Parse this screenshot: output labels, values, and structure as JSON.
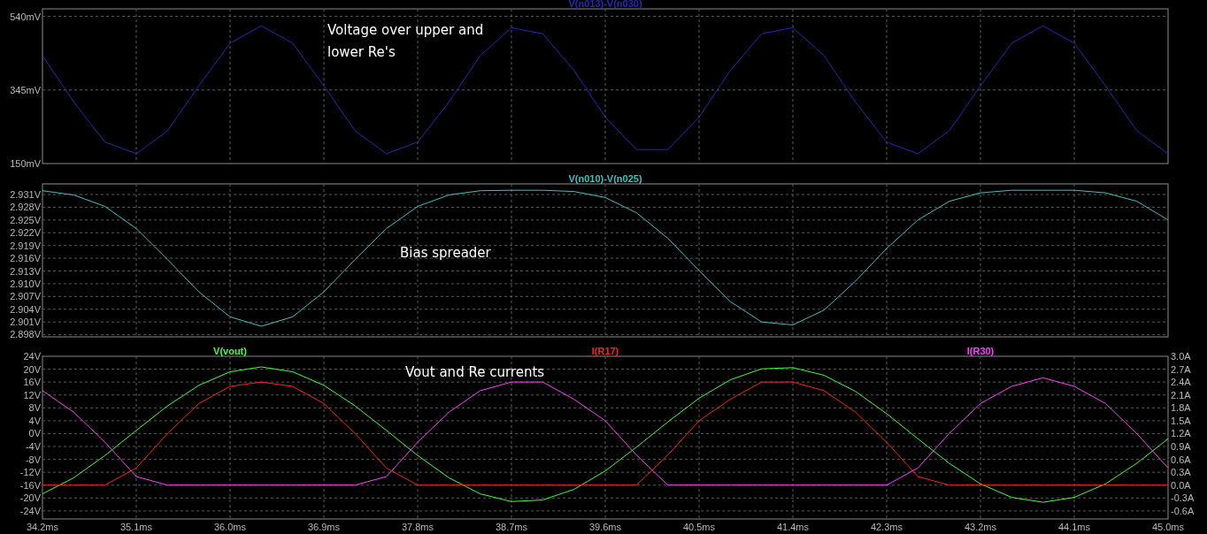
{
  "panes": [
    {
      "chart_data": {
        "type": "line",
        "xlim": [
          34.2,
          45.0
        ],
        "ylim": [
          150,
          560
        ],
        "yticks": [
          {
            "value": 540,
            "label": "540mV"
          },
          {
            "value": 345,
            "label": "345mV"
          },
          {
            "value": 150,
            "label": "150mV"
          }
        ],
        "x": [
          34.2,
          34.5,
          34.8,
          35.1,
          35.4,
          35.7,
          36.0,
          36.3,
          36.6,
          36.9,
          37.2,
          37.5,
          37.8,
          38.1,
          38.4,
          38.7,
          39.0,
          39.3,
          39.6,
          39.9,
          40.2,
          40.5,
          40.8,
          41.1,
          41.4,
          41.7,
          42.0,
          42.3,
          42.6,
          42.9,
          43.2,
          43.5,
          43.8,
          44.1,
          44.4,
          44.7,
          45.0
        ],
        "series": [
          {
            "name": "V(n013)-V(n030)",
            "color": "#2828b8",
            "values": [
              436,
              313,
              207,
              176,
              237,
              356,
              469,
              515,
              469,
              356,
              237,
              176,
              207,
              313,
              436,
              510,
              494,
              397,
              273,
              187,
              187,
              273,
              397,
              494,
              510,
              436,
              313,
              207,
              176,
              237,
              356,
              469,
              515,
              469,
              356,
              237,
              176
            ]
          }
        ],
        "grid": true,
        "annotations": [
          "Voltage over upper and lower Re's"
        ]
      }
    },
    {
      "chart_data": {
        "type": "line",
        "xlim": [
          34.2,
          45.0
        ],
        "ylim": [
          2.8975,
          2.9335
        ],
        "yticks": [
          {
            "value": 2.931,
            "label": "2.931V"
          },
          {
            "value": 2.928,
            "label": "2.928V"
          },
          {
            "value": 2.925,
            "label": "2.925V"
          },
          {
            "value": 2.922,
            "label": "2.922V"
          },
          {
            "value": 2.919,
            "label": "2.919V"
          },
          {
            "value": 2.916,
            "label": "2.916V"
          },
          {
            "value": 2.913,
            "label": "2.913V"
          },
          {
            "value": 2.91,
            "label": "2.910V"
          },
          {
            "value": 2.907,
            "label": "2.907V"
          },
          {
            "value": 2.904,
            "label": "2.904V"
          },
          {
            "value": 2.901,
            "label": "2.901V"
          },
          {
            "value": 2.898,
            "label": "2.898V"
          }
        ],
        "x": [
          34.2,
          34.5,
          34.8,
          35.1,
          35.4,
          35.7,
          36.0,
          36.3,
          36.6,
          36.9,
          37.2,
          37.5,
          37.8,
          38.1,
          38.4,
          38.7,
          39.0,
          39.3,
          39.6,
          39.9,
          40.2,
          40.5,
          40.8,
          41.1,
          41.4,
          41.7,
          42.0,
          42.3,
          42.6,
          42.9,
          43.2,
          43.5,
          43.8,
          44.1,
          44.4,
          44.7,
          45.0
        ],
        "series": [
          {
            "name": "V(n010)-V(n025)",
            "color": "#40c0c0",
            "values": [
              2.9319,
              2.9309,
              2.9282,
              2.923,
              2.9157,
              2.9081,
              2.9022,
              2.9,
              2.9022,
              2.9081,
              2.9157,
              2.923,
              2.9282,
              2.9309,
              2.9319,
              2.932,
              2.932,
              2.9317,
              2.9303,
              2.9267,
              2.9207,
              2.9131,
              2.9058,
              2.901,
              2.9003,
              2.9038,
              2.9106,
              2.9183,
              2.925,
              2.9294,
              2.9314,
              2.932,
              2.932,
              2.932,
              2.9314,
              2.9294,
              2.925
            ]
          }
        ],
        "grid": true,
        "annotations": [
          "Bias spreader"
        ]
      }
    },
    {
      "chart_data": {
        "type": "line",
        "xlim": [
          34.2,
          45.0
        ],
        "ylim": [
          -26.5,
          24
        ],
        "y2lim": [
          -0.7875,
          3.0
        ],
        "xticks": [
          {
            "value": 34.2,
            "label": "34.2ms"
          },
          {
            "value": 35.1,
            "label": "35.1ms"
          },
          {
            "value": 36.0,
            "label": "36.0ms"
          },
          {
            "value": 36.9,
            "label": "36.9ms"
          },
          {
            "value": 37.8,
            "label": "37.8ms"
          },
          {
            "value": 38.7,
            "label": "38.7ms"
          },
          {
            "value": 39.6,
            "label": "39.6ms"
          },
          {
            "value": 40.5,
            "label": "40.5ms"
          },
          {
            "value": 41.4,
            "label": "41.4ms"
          },
          {
            "value": 42.3,
            "label": "42.3ms"
          },
          {
            "value": 43.2,
            "label": "43.2ms"
          },
          {
            "value": 44.1,
            "label": "44.1ms"
          },
          {
            "value": 45.0,
            "label": "45.0ms"
          }
        ],
        "yticks": [
          {
            "value": 24,
            "label": "24V"
          },
          {
            "value": 20,
            "label": "20V"
          },
          {
            "value": 16,
            "label": "16V"
          },
          {
            "value": 12,
            "label": "12V"
          },
          {
            "value": 8,
            "label": "8V"
          },
          {
            "value": 4,
            "label": "4V"
          },
          {
            "value": 0,
            "label": "0V"
          },
          {
            "value": -4,
            "label": "-4V"
          },
          {
            "value": -8,
            "label": "-8V"
          },
          {
            "value": -12,
            "label": "-12V"
          },
          {
            "value": -16,
            "label": "-16V"
          },
          {
            "value": -20,
            "label": "-20V"
          },
          {
            "value": -24,
            "label": "-24V"
          }
        ],
        "y2ticks": [
          {
            "value": 3.0,
            "label": "3.0A"
          },
          {
            "value": 2.7,
            "label": "2.7A"
          },
          {
            "value": 2.4,
            "label": "2.4A"
          },
          {
            "value": 2.1,
            "label": "2.1A"
          },
          {
            "value": 1.8,
            "label": "1.8A"
          },
          {
            "value": 1.5,
            "label": "1.5A"
          },
          {
            "value": 1.2,
            "label": "1.2A"
          },
          {
            "value": 0.9,
            "label": "0.9A"
          },
          {
            "value": 0.6,
            "label": "0.6A"
          },
          {
            "value": 0.3,
            "label": "0.3A"
          },
          {
            "value": 0.0,
            "label": "0.0A"
          },
          {
            "value": -0.3,
            "label": "-0.3A"
          },
          {
            "value": -0.6,
            "label": "-0.6A"
          }
        ],
        "x": [
          34.2,
          34.5,
          34.8,
          35.1,
          35.4,
          35.7,
          36.0,
          36.3,
          36.6,
          36.9,
          37.2,
          37.5,
          37.8,
          38.1,
          38.4,
          38.7,
          39.0,
          39.3,
          39.6,
          39.9,
          40.2,
          40.5,
          40.8,
          41.1,
          41.4,
          41.7,
          42.0,
          42.3,
          42.6,
          42.9,
          43.2,
          43.5,
          43.8,
          44.1,
          44.4,
          44.7,
          45.0
        ],
        "series": [
          {
            "name": "V(vout)",
            "color": "#40ff40",
            "values": [
              -18.7,
              -13.7,
              -6.8,
              1.0,
              8.6,
              15.0,
              19.2,
              20.7,
              19.2,
              15.0,
              8.6,
              1.0,
              -6.8,
              -13.7,
              -18.7,
              -21.1,
              -20.6,
              -17.3,
              -11.6,
              -4.2,
              3.6,
              11.0,
              16.7,
              20.1,
              20.5,
              18.1,
              13.1,
              6.2,
              -1.6,
              -9.2,
              -15.6,
              -19.8,
              -21.3,
              -19.8,
              -15.6,
              -9.2,
              -1.6
            ]
          },
          {
            "name": "I(R17)",
            "color": "#ff2020",
            "axis": "y2",
            "values": [
              0,
              0,
              0,
              0.4,
              1.2,
              1.9,
              2.3,
              2.4,
              2.3,
              1.9,
              1.2,
              0.4,
              0,
              0,
              0,
              0,
              0,
              0,
              0,
              0,
              0.7,
              1.5,
              2.0,
              2.4,
              2.4,
              2.2,
              1.7,
              1.0,
              0.2,
              0,
              0,
              0,
              0,
              0,
              0,
              0,
              0
            ]
          },
          {
            "name": "I(R30)",
            "color": "#ff40ff",
            "axis": "y2",
            "values": [
              2.2,
              1.7,
              1.0,
              0.2,
              0,
              0,
              0,
              0,
              0,
              0,
              0,
              0.2,
              1.0,
              1.7,
              2.2,
              2.4,
              2.4,
              2.0,
              1.5,
              0.7,
              0,
              0,
              0,
              0,
              0,
              0,
              0,
              0,
              0.4,
              1.2,
              1.9,
              2.3,
              2.5,
              2.3,
              1.9,
              1.2,
              0.4
            ]
          }
        ],
        "grid": true,
        "annotations": [
          "Vout and Re currents"
        ]
      }
    }
  ]
}
